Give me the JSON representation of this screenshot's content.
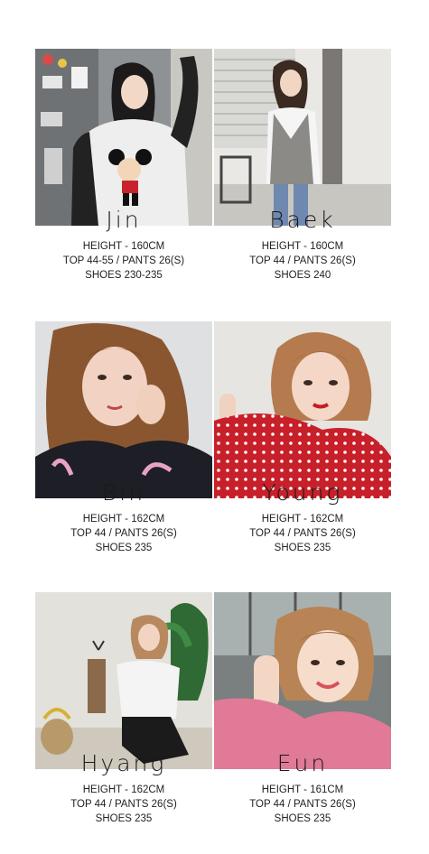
{
  "models": [
    {
      "name": "Jin",
      "height": "HEIGHT - 160CM",
      "top_pants": "TOP 44-55 / PANTS 26(S)",
      "shoes": "SHOES 230-235"
    },
    {
      "name": "Baek",
      "height": "HEIGHT - 160CM",
      "top_pants": "TOP 44 / PANTS 26(S)",
      "shoes": "SHOES 240"
    },
    {
      "name": "Bin",
      "height": "HEIGHT - 162CM",
      "top_pants": "TOP 44 / PANTS 26(S)",
      "shoes": "SHOES 235"
    },
    {
      "name": "Young",
      "height": "HEIGHT - 162CM",
      "top_pants": "TOP 44 / PANTS 26(S)",
      "shoes": "SHOES 235"
    },
    {
      "name": "Hyang",
      "height": "HEIGHT - 162CM",
      "top_pants": "TOP 44 / PANTS 26(S)",
      "shoes": "SHOES 235"
    },
    {
      "name": "Eun",
      "height": "HEIGHT - 161CM",
      "top_pants": "TOP 44 / PANTS 26(S)",
      "shoes": "SHOES 235"
    }
  ]
}
